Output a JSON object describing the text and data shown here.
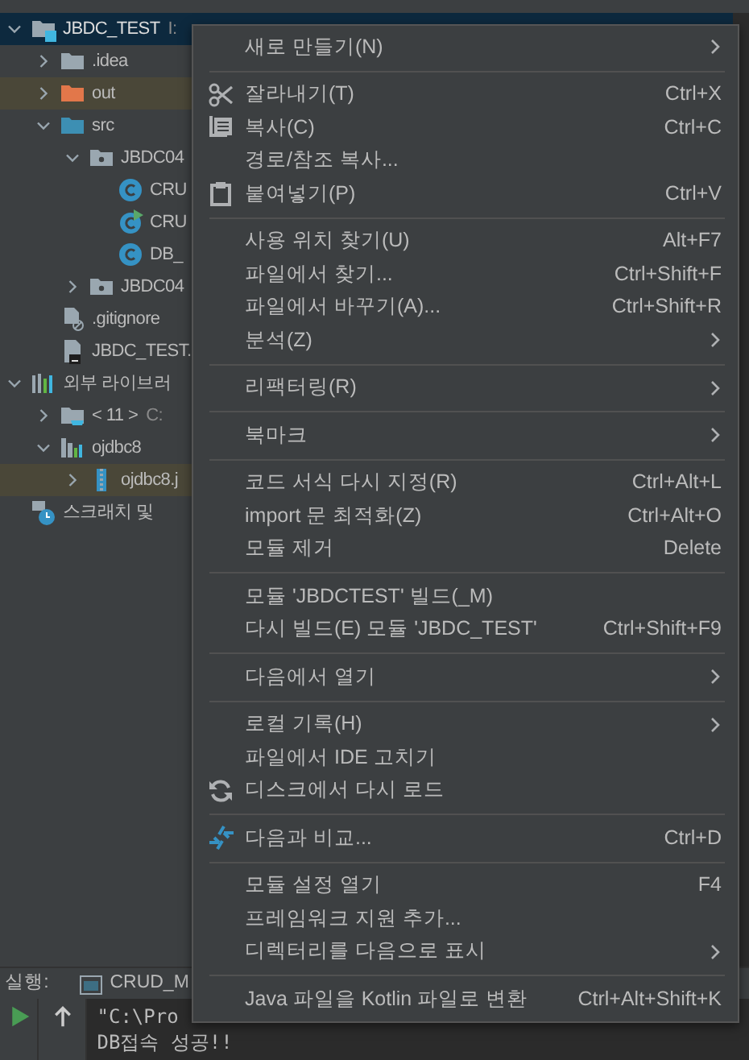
{
  "project_tree": [
    {
      "label": "JBDC_TEST",
      "path": "I:",
      "kind": "module",
      "expanded": true,
      "selected": true,
      "highlighted": false,
      "children": [
        {
          "label": ".idea",
          "kind": "folder",
          "expanded": false,
          "selected": false,
          "highlighted": false
        },
        {
          "label": "out",
          "kind": "excluded-folder",
          "expanded": false,
          "selected": false,
          "highlighted": true
        },
        {
          "label": "src",
          "kind": "source-folder",
          "expanded": true,
          "selected": false,
          "highlighted": false,
          "children": [
            {
              "label": "JBDC04",
              "kind": "package",
              "expanded": true,
              "selected": false,
              "highlighted": false,
              "children": [
                {
                  "label": "CRU",
                  "kind": "class",
                  "selected": false,
                  "highlighted": false
                },
                {
                  "label": "CRU",
                  "kind": "runnable-class",
                  "selected": false,
                  "highlighted": false
                },
                {
                  "label": "DB_",
                  "kind": "class",
                  "selected": false,
                  "highlighted": false
                }
              ]
            },
            {
              "label": "JBDC04",
              "kind": "package",
              "expanded": false,
              "selected": false,
              "highlighted": false
            }
          ]
        },
        {
          "label": ".gitignore",
          "kind": "ignore-file",
          "selected": false,
          "highlighted": false
        },
        {
          "label": "JBDC_TEST.",
          "kind": "module-file",
          "selected": false,
          "highlighted": false
        }
      ]
    },
    {
      "label": "외부 라이브러",
      "kind": "libraries",
      "expanded": true,
      "selected": false,
      "highlighted": false,
      "children": [
        {
          "label": "< 11 >",
          "path": "C:",
          "kind": "jdk",
          "expanded": false,
          "selected": false,
          "highlighted": false
        },
        {
          "label": "ojdbc8",
          "kind": "library",
          "expanded": true,
          "selected": false,
          "highlighted": false,
          "children": [
            {
              "label": "ojdbc8.j",
              "kind": "jar",
              "expanded": false,
              "selected": false,
              "highlighted": true
            }
          ]
        }
      ]
    },
    {
      "label": "스크래치 및",
      "kind": "scratches",
      "selected": false,
      "highlighted": false
    }
  ],
  "context_menu": [
    [
      {
        "label": "새로 만들기(N)",
        "kind": "plain",
        "submenu": true
      }
    ],
    [
      {
        "label": "잘라내기(T)",
        "kind": "cut",
        "shortcut": "Ctrl+X",
        "submenu": false
      },
      {
        "label": "복사(C)",
        "kind": "copy",
        "shortcut": "Ctrl+C",
        "submenu": false
      },
      {
        "label": "경로/참조 복사...",
        "kind": "plain",
        "submenu": false
      },
      {
        "label": "붙여넣기(P)",
        "kind": "paste",
        "shortcut": "Ctrl+V",
        "submenu": false
      }
    ],
    [
      {
        "label": "사용 위치 찾기(U)",
        "kind": "plain",
        "shortcut": "Alt+F7",
        "submenu": false
      },
      {
        "label": "파일에서 찾기...",
        "kind": "plain",
        "shortcut": "Ctrl+Shift+F",
        "submenu": false
      },
      {
        "label": "파일에서 바꾸기(A)...",
        "kind": "plain",
        "shortcut": "Ctrl+Shift+R",
        "submenu": false
      },
      {
        "label": "분석(Z)",
        "kind": "plain",
        "submenu": true
      }
    ],
    [
      {
        "label": "리팩터링(R)",
        "kind": "plain",
        "submenu": true
      }
    ],
    [
      {
        "label": "북마크",
        "kind": "plain",
        "submenu": true
      }
    ],
    [
      {
        "label": "코드 서식 다시 지정(R)",
        "kind": "plain",
        "shortcut": "Ctrl+Alt+L",
        "submenu": false
      },
      {
        "label": "import 문 최적화(Z)",
        "kind": "plain",
        "shortcut": "Ctrl+Alt+O",
        "submenu": false
      },
      {
        "label": "모듈 제거",
        "kind": "plain",
        "shortcut": "Delete",
        "submenu": false
      }
    ],
    [
      {
        "label": "모듈 'JBDCTEST' 빌드(_M)",
        "kind": "plain",
        "submenu": false
      },
      {
        "label": "다시 빌드(E) 모듈 'JBDC_TEST'",
        "kind": "plain",
        "shortcut": "Ctrl+Shift+F9",
        "submenu": false
      }
    ],
    [
      {
        "label": "다음에서 열기",
        "kind": "plain",
        "submenu": true
      }
    ],
    [
      {
        "label": "로컬 기록(H)",
        "kind": "plain",
        "submenu": true
      },
      {
        "label": "파일에서 IDE 고치기",
        "kind": "plain",
        "submenu": false
      },
      {
        "label": "디스크에서 다시 로드",
        "kind": "reload",
        "submenu": false
      }
    ],
    [
      {
        "label": "다음과 비교...",
        "kind": "compare",
        "shortcut": "Ctrl+D",
        "submenu": false
      }
    ],
    [
      {
        "label": "모듈 설정 열기",
        "kind": "plain",
        "shortcut": "F4",
        "submenu": false
      },
      {
        "label": "프레임워크 지원 추가...",
        "kind": "plain",
        "submenu": false
      },
      {
        "label": "디렉터리를 다음으로 표시",
        "kind": "plain",
        "submenu": true
      }
    ],
    [
      {
        "label": "Java 파일을 Kotlin 파일로 변환",
        "kind": "plain",
        "shortcut": "Ctrl+Alt+Shift+K",
        "submenu": false
      }
    ]
  ],
  "run_panel": {
    "title": "실행:",
    "tab": "CRUD_M",
    "console": [
      {
        "text": "\"C:\\Pro"
      },
      {
        "text": "DB접속 성공!!"
      }
    ]
  }
}
